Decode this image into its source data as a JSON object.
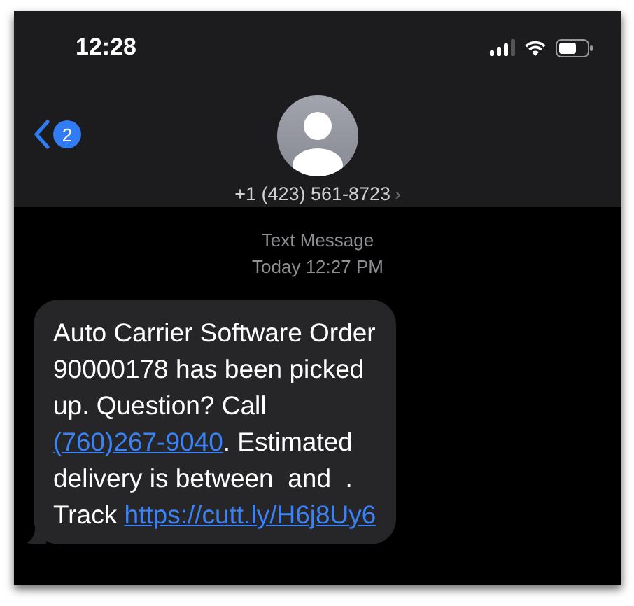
{
  "status_bar": {
    "time": "12:28"
  },
  "header": {
    "back_badge": "2",
    "contact": "+1 (423) 561-8723",
    "chevron": "›"
  },
  "conversation": {
    "label": "Text Message",
    "timestamp": "Today 12:27 PM",
    "message": {
      "lines": [
        [
          {
            "kind": "text",
            "text": "Auto Carrier Software Order"
          }
        ],
        [
          {
            "kind": "text",
            "text": "90000178 has been picked"
          }
        ],
        [
          {
            "kind": "text",
            "text": "up. Question? Call"
          }
        ],
        [
          {
            "kind": "link",
            "text": "(760)267-9040"
          },
          {
            "kind": "text",
            "text": ". Estimated"
          }
        ],
        [
          {
            "kind": "text",
            "text": "delivery is between  and  ."
          }
        ],
        [
          {
            "kind": "text",
            "text": "Track "
          },
          {
            "kind": "link",
            "text": "https://cutt.ly/H6j8Uy6"
          }
        ]
      ]
    }
  }
}
